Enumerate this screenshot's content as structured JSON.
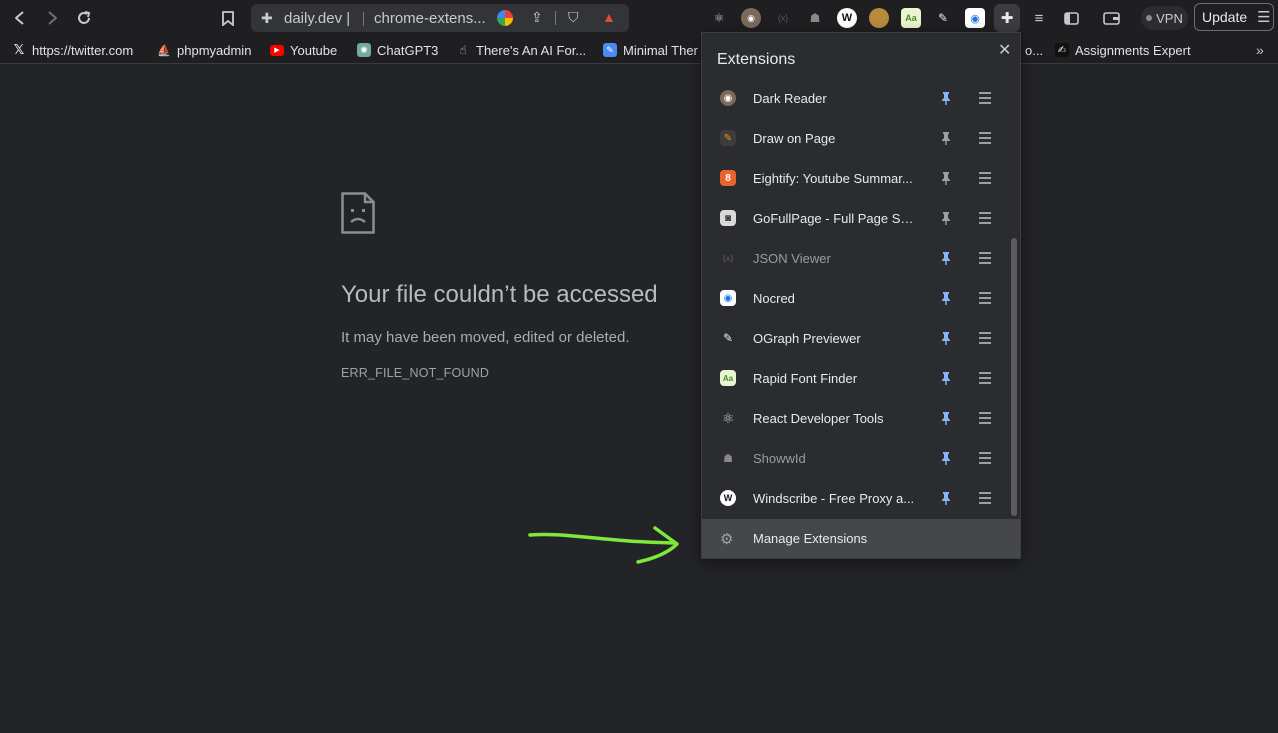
{
  "browser": {
    "tabs": [
      "daily.dev |",
      "chrome-extens..."
    ],
    "vpn_label": "VPN",
    "update_label": "Update"
  },
  "toolbar_extension_icons": [
    "react-icon",
    "dark-reader-icon",
    "json-viewer-icon",
    "showwid-icon",
    "windscribe-icon",
    "cookie-icon",
    "rapid-font-icon",
    "ograph-icon",
    "nocred-icon",
    "puzzle-icon",
    "playlist-icon",
    "sidebar-icon",
    "wallet-icon"
  ],
  "bookmarks": [
    {
      "label": "https://twitter.com",
      "icon": "x-logo-icon",
      "color": "#e8eaed"
    },
    {
      "label": "phpmyadmin",
      "icon": "phpmyadmin-icon",
      "color": "#f29111"
    },
    {
      "label": "Youtube",
      "icon": "youtube-icon",
      "color": "#ff0000"
    },
    {
      "label": "ChatGPT3",
      "icon": "chatgpt-icon",
      "color": "#74aa9c"
    },
    {
      "label": "There's An AI For...",
      "icon": "ai-for-icon",
      "color": "#c8c8c8"
    },
    {
      "label": "Minimal Ther",
      "icon": "minimal-icon",
      "color": "#4a8af4"
    },
    {
      "label": "o...",
      "icon": "",
      "color": ""
    },
    {
      "label": "Assignments Expert",
      "icon": "assignments-icon",
      "color": "#e8eaed"
    }
  ],
  "error": {
    "title": "Your file couldn’t be accessed",
    "subtitle": "It may have been moved, edited or deleted.",
    "code": "ERR_FILE_NOT_FOUND"
  },
  "extensions_popup": {
    "title": "Extensions",
    "items": [
      {
        "name": "Dark Reader",
        "icon": "dark-reader-icon",
        "pinned": true,
        "dim": false
      },
      {
        "name": "Draw on Page",
        "icon": "draw-on-page-icon",
        "pinned": false,
        "dim": false
      },
      {
        "name": "Eightify: Youtube Summar...",
        "icon": "eightify-icon",
        "pinned": false,
        "dim": false
      },
      {
        "name": "GoFullPage - Full Page Scr...",
        "icon": "camera-icon",
        "pinned": false,
        "dim": false
      },
      {
        "name": "JSON Viewer",
        "icon": "json-viewer-icon",
        "pinned": true,
        "dim": true
      },
      {
        "name": "Nocred",
        "icon": "nocred-icon",
        "pinned": true,
        "dim": false
      },
      {
        "name": "OGraph Previewer",
        "icon": "ograph-icon",
        "pinned": true,
        "dim": false
      },
      {
        "name": "Rapid Font Finder",
        "icon": "rapid-font-icon",
        "pinned": true,
        "dim": false
      },
      {
        "name": "React Developer Tools",
        "icon": "react-icon",
        "pinned": true,
        "dim": false
      },
      {
        "name": "ShowwId",
        "icon": "showwid-icon",
        "pinned": true,
        "dim": true
      },
      {
        "name": "Windscribe - Free Proxy a...",
        "icon": "windscribe-icon",
        "pinned": true,
        "dim": false
      }
    ],
    "manage_label": "Manage Extensions"
  },
  "colors": {
    "pinned": "#8ab4f8",
    "unpinned": "#9aa0a6",
    "arrow": "#7ee83b"
  }
}
